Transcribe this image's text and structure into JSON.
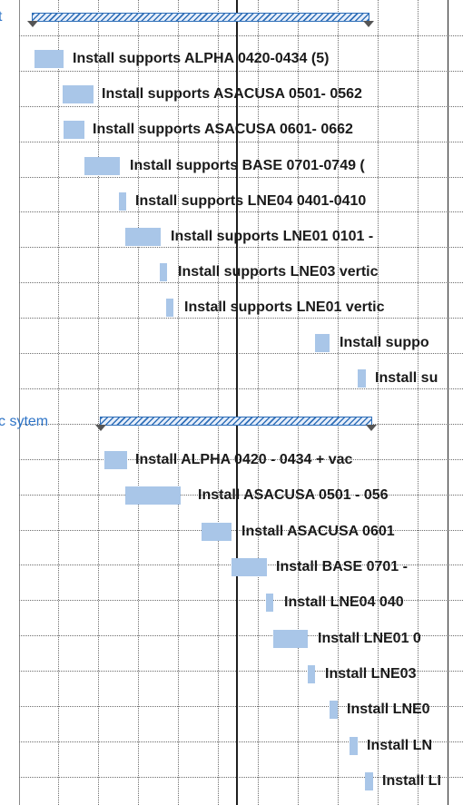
{
  "groups": [
    {
      "label_fragment": "t",
      "tasks": [
        "Install supports ALPHA 0420-0434 (5)",
        "Install supports ASACUSA 0501- 0562",
        "Install supports ASACUSA 0601- 0662",
        "Install supports BASE 0701-0749 (",
        "Install supports LNE04 0401-0410",
        "Install supports LNE01 0101 -",
        "Install supports LNE03 vertic",
        "Install supports LNE01 vertic",
        "Install suppo",
        "Install su"
      ]
    },
    {
      "label_fragment": "c sytem",
      "tasks": [
        "Install ALPHA  0420 - 0434 + vac",
        "Install ASACUSA 0501 - 056",
        "Install ASACUSA 0601",
        "Install BASE 0701 -",
        "Install LNE04 040",
        "Install LNE01 0",
        "Install LNE03",
        "Install LNE0",
        "Install LN",
        "Install LI"
      ]
    }
  ],
  "colors": {
    "task_bar": "#a9c6e8",
    "summary_bar": "#2f6fb8",
    "group_label": "#2e74c7",
    "today_line": "#1f1f1f",
    "grid": "#6d6d6d"
  }
}
